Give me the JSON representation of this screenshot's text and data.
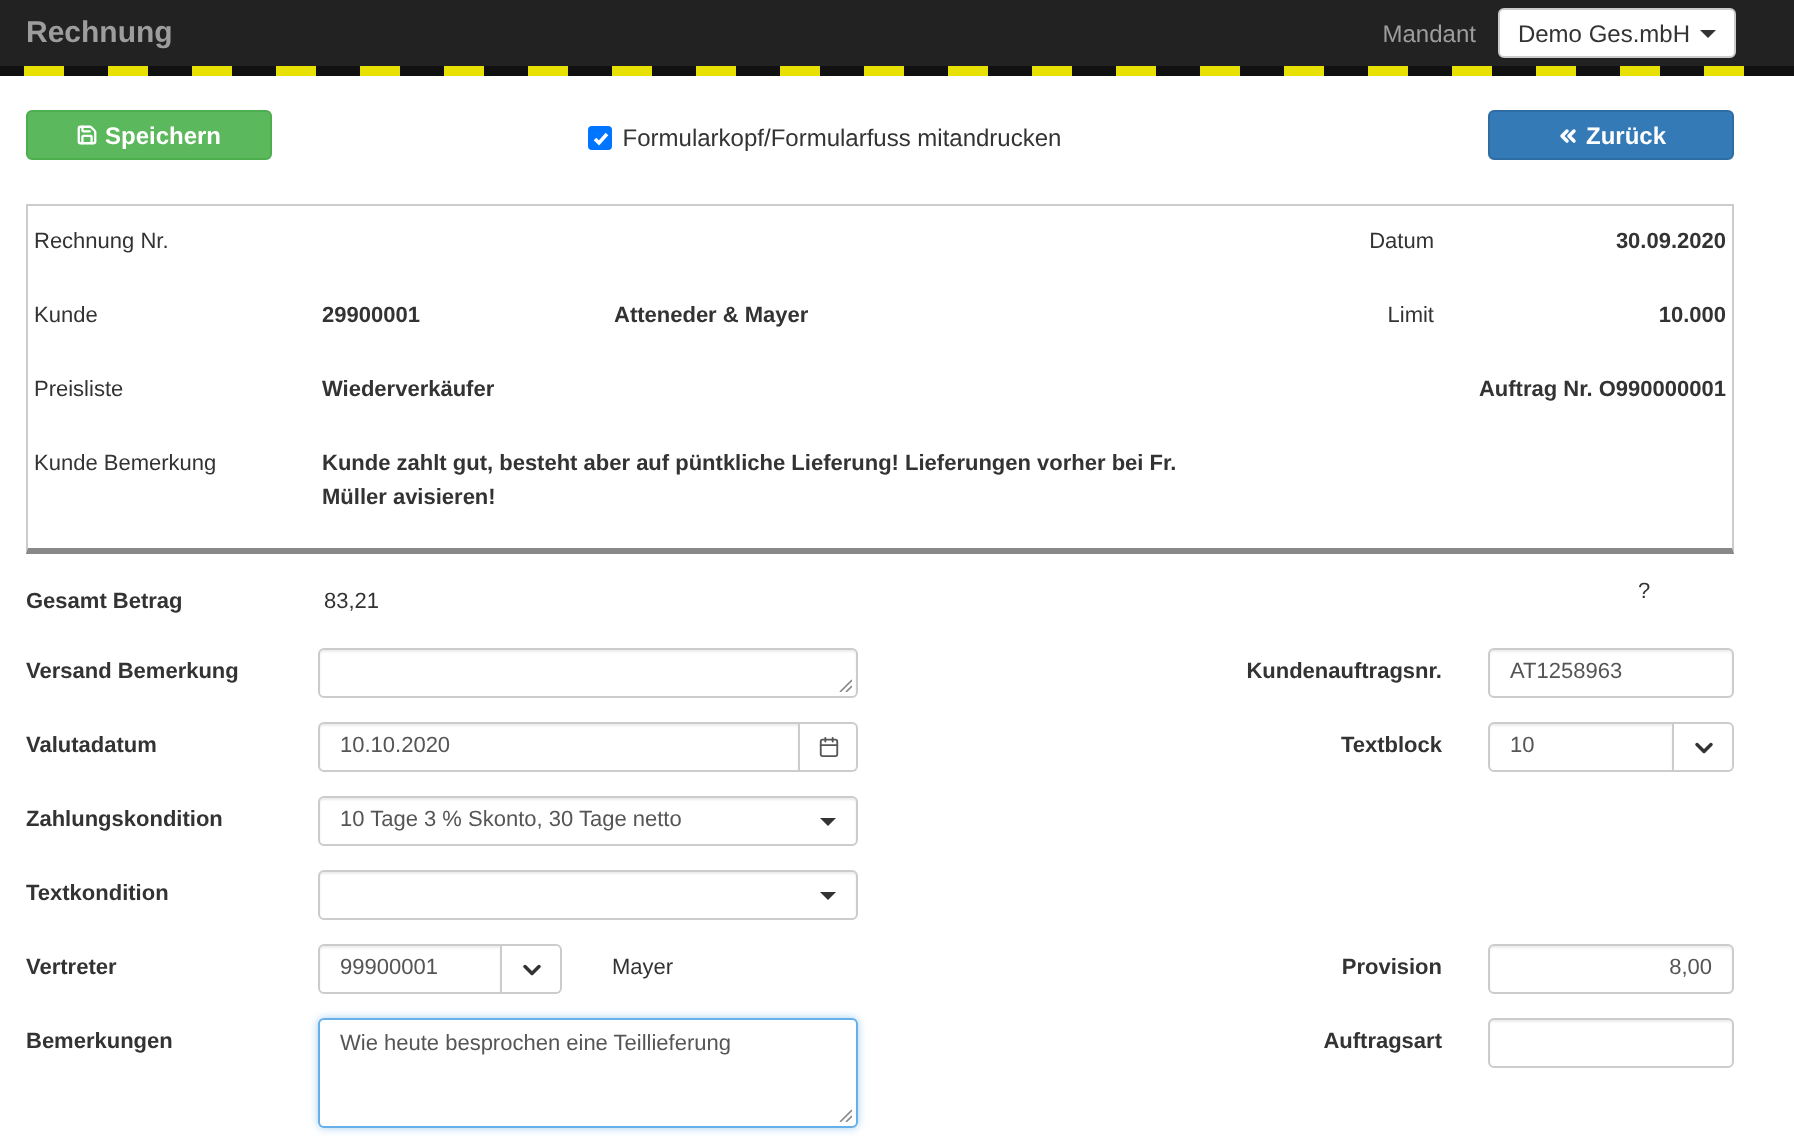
{
  "navbar": {
    "title": "Rechnung",
    "mandant_label": "Mandant",
    "mandant_value": "Demo Ges.mbH"
  },
  "toolbar": {
    "save_button": "Speichern",
    "print_checkbox": {
      "label": "Formularkopf/Formularfuss mitandrucken",
      "checked": true
    },
    "back_button": "Zurück"
  },
  "header": {
    "rows": [
      {
        "label": "Rechnung Nr.",
        "right_label": "Datum",
        "right_value": "30.09.2020"
      },
      {
        "label": "Kunde",
        "value": "29900001",
        "name": "Atteneder & Mayer",
        "right_label": "Limit",
        "right_value": "10.000"
      },
      {
        "label": "Preisliste",
        "value": "Wiederverkäufer",
        "right_value": "Auftrag Nr. O990000001"
      },
      {
        "label": "Kunde Bemerkung",
        "note": "Kunde zahlt gut, besteht aber auf püntkliche Lieferung! Lieferungen vorher bei Fr. Müller avisieren!"
      }
    ]
  },
  "form": {
    "rows": [
      {
        "left": {
          "label": "Gesamt Betrag",
          "kind": "static",
          "value": "83,21"
        },
        "right": {
          "kind": "help",
          "value": "?"
        }
      },
      {
        "left": {
          "label": "Versand Bemerkung",
          "kind": "textarea"
        },
        "right": {
          "label": "Kundenauftragsnr.",
          "kind": "text",
          "value": "AT1258963"
        }
      },
      {
        "left": {
          "label": "Valutadatum",
          "kind": "date",
          "value": "10.10.2020"
        },
        "right": {
          "label": "Textblock",
          "kind": "combo",
          "value": "10"
        }
      },
      {
        "left": {
          "label": "Zahlungskondition",
          "kind": "select",
          "value": "10 Tage 3 % Skonto, 30 Tage netto"
        }
      },
      {
        "left": {
          "label": "Textkondition",
          "kind": "select"
        }
      },
      {
        "left": {
          "label": "Vertreter",
          "kind": "combo",
          "value": "99900001",
          "extra": "Mayer"
        },
        "right": {
          "label": "Provision",
          "kind": "number",
          "value": "8,00"
        }
      },
      {
        "left": {
          "label": "Bemerkungen",
          "kind": "bigtextarea",
          "value": "Wie heute besprochen eine Teillieferung",
          "focused": true
        },
        "right": {
          "label": "Auftragsart",
          "kind": "text"
        }
      }
    ]
  }
}
